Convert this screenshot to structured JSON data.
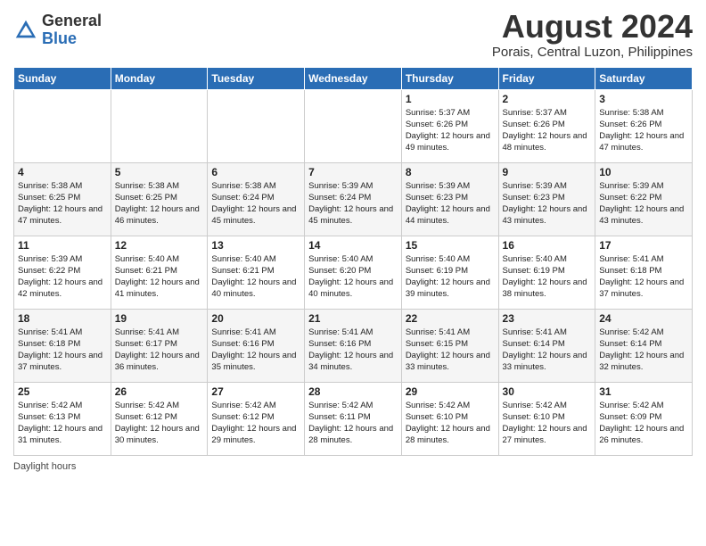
{
  "header": {
    "logo_general": "General",
    "logo_blue": "Blue",
    "month_title": "August 2024",
    "location": "Porais, Central Luzon, Philippines"
  },
  "days_of_week": [
    "Sunday",
    "Monday",
    "Tuesday",
    "Wednesday",
    "Thursday",
    "Friday",
    "Saturday"
  ],
  "weeks": [
    [
      {
        "day": "",
        "info": ""
      },
      {
        "day": "",
        "info": ""
      },
      {
        "day": "",
        "info": ""
      },
      {
        "day": "",
        "info": ""
      },
      {
        "day": "1",
        "info": "Sunrise: 5:37 AM\nSunset: 6:26 PM\nDaylight: 12 hours\nand 49 minutes."
      },
      {
        "day": "2",
        "info": "Sunrise: 5:37 AM\nSunset: 6:26 PM\nDaylight: 12 hours\nand 48 minutes."
      },
      {
        "day": "3",
        "info": "Sunrise: 5:38 AM\nSunset: 6:26 PM\nDaylight: 12 hours\nand 47 minutes."
      }
    ],
    [
      {
        "day": "4",
        "info": "Sunrise: 5:38 AM\nSunset: 6:25 PM\nDaylight: 12 hours\nand 47 minutes."
      },
      {
        "day": "5",
        "info": "Sunrise: 5:38 AM\nSunset: 6:25 PM\nDaylight: 12 hours\nand 46 minutes."
      },
      {
        "day": "6",
        "info": "Sunrise: 5:38 AM\nSunset: 6:24 PM\nDaylight: 12 hours\nand 45 minutes."
      },
      {
        "day": "7",
        "info": "Sunrise: 5:39 AM\nSunset: 6:24 PM\nDaylight: 12 hours\nand 45 minutes."
      },
      {
        "day": "8",
        "info": "Sunrise: 5:39 AM\nSunset: 6:23 PM\nDaylight: 12 hours\nand 44 minutes."
      },
      {
        "day": "9",
        "info": "Sunrise: 5:39 AM\nSunset: 6:23 PM\nDaylight: 12 hours\nand 43 minutes."
      },
      {
        "day": "10",
        "info": "Sunrise: 5:39 AM\nSunset: 6:22 PM\nDaylight: 12 hours\nand 43 minutes."
      }
    ],
    [
      {
        "day": "11",
        "info": "Sunrise: 5:39 AM\nSunset: 6:22 PM\nDaylight: 12 hours\nand 42 minutes."
      },
      {
        "day": "12",
        "info": "Sunrise: 5:40 AM\nSunset: 6:21 PM\nDaylight: 12 hours\nand 41 minutes."
      },
      {
        "day": "13",
        "info": "Sunrise: 5:40 AM\nSunset: 6:21 PM\nDaylight: 12 hours\nand 40 minutes."
      },
      {
        "day": "14",
        "info": "Sunrise: 5:40 AM\nSunset: 6:20 PM\nDaylight: 12 hours\nand 40 minutes."
      },
      {
        "day": "15",
        "info": "Sunrise: 5:40 AM\nSunset: 6:19 PM\nDaylight: 12 hours\nand 39 minutes."
      },
      {
        "day": "16",
        "info": "Sunrise: 5:40 AM\nSunset: 6:19 PM\nDaylight: 12 hours\nand 38 minutes."
      },
      {
        "day": "17",
        "info": "Sunrise: 5:41 AM\nSunset: 6:18 PM\nDaylight: 12 hours\nand 37 minutes."
      }
    ],
    [
      {
        "day": "18",
        "info": "Sunrise: 5:41 AM\nSunset: 6:18 PM\nDaylight: 12 hours\nand 37 minutes."
      },
      {
        "day": "19",
        "info": "Sunrise: 5:41 AM\nSunset: 6:17 PM\nDaylight: 12 hours\nand 36 minutes."
      },
      {
        "day": "20",
        "info": "Sunrise: 5:41 AM\nSunset: 6:16 PM\nDaylight: 12 hours\nand 35 minutes."
      },
      {
        "day": "21",
        "info": "Sunrise: 5:41 AM\nSunset: 6:16 PM\nDaylight: 12 hours\nand 34 minutes."
      },
      {
        "day": "22",
        "info": "Sunrise: 5:41 AM\nSunset: 6:15 PM\nDaylight: 12 hours\nand 33 minutes."
      },
      {
        "day": "23",
        "info": "Sunrise: 5:41 AM\nSunset: 6:14 PM\nDaylight: 12 hours\nand 33 minutes."
      },
      {
        "day": "24",
        "info": "Sunrise: 5:42 AM\nSunset: 6:14 PM\nDaylight: 12 hours\nand 32 minutes."
      }
    ],
    [
      {
        "day": "25",
        "info": "Sunrise: 5:42 AM\nSunset: 6:13 PM\nDaylight: 12 hours\nand 31 minutes."
      },
      {
        "day": "26",
        "info": "Sunrise: 5:42 AM\nSunset: 6:12 PM\nDaylight: 12 hours\nand 30 minutes."
      },
      {
        "day": "27",
        "info": "Sunrise: 5:42 AM\nSunset: 6:12 PM\nDaylight: 12 hours\nand 29 minutes."
      },
      {
        "day": "28",
        "info": "Sunrise: 5:42 AM\nSunset: 6:11 PM\nDaylight: 12 hours\nand 28 minutes."
      },
      {
        "day": "29",
        "info": "Sunrise: 5:42 AM\nSunset: 6:10 PM\nDaylight: 12 hours\nand 28 minutes."
      },
      {
        "day": "30",
        "info": "Sunrise: 5:42 AM\nSunset: 6:10 PM\nDaylight: 12 hours\nand 27 minutes."
      },
      {
        "day": "31",
        "info": "Sunrise: 5:42 AM\nSunset: 6:09 PM\nDaylight: 12 hours\nand 26 minutes."
      }
    ]
  ],
  "footer": {
    "daylight_hours_label": "Daylight hours"
  }
}
